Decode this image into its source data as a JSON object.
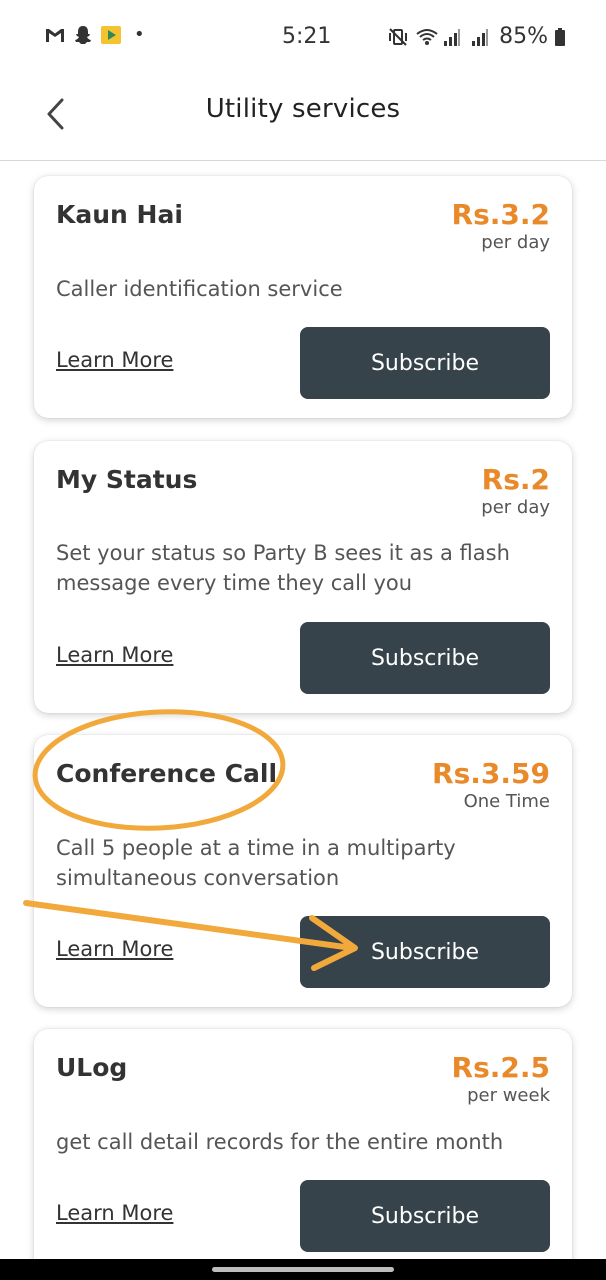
{
  "status_bar": {
    "time": "5:21",
    "battery": "85%",
    "notification_icons": [
      "gmail-icon",
      "snapchat-icon",
      "play-store-icon"
    ],
    "system_icons": [
      "vibrate-icon",
      "wifi-icon",
      "signal-icon",
      "signal-icon",
      "battery-icon"
    ]
  },
  "header": {
    "title": "Utility services",
    "back_icon": "chevron-left-icon"
  },
  "services": [
    {
      "name": "Kaun Hai",
      "price": "Rs.3.2",
      "period": "per day",
      "description": "Caller identification service",
      "learn_more": "Learn More",
      "subscribe": "Subscribe"
    },
    {
      "name": "My Status",
      "price": "Rs.2",
      "period": "per day",
      "description": "Set your status so Party B sees it as a flash message every time they call you",
      "learn_more": "Learn More",
      "subscribe": "Subscribe"
    },
    {
      "name": "Conference Call",
      "price": "Rs.3.59",
      "period": "One Time",
      "description": "Call 5 people at a time in a multiparty simultaneous conversation",
      "learn_more": "Learn More",
      "subscribe": "Subscribe"
    },
    {
      "name": "ULog",
      "price": "Rs.2.5",
      "period": "per week",
      "description": "get call detail records for the entire month",
      "learn_more": "Learn More",
      "subscribe": "Subscribe"
    }
  ],
  "colors": {
    "price_accent": "#e8892a",
    "button_bg": "#36434a",
    "annotation": "#f2a93b"
  }
}
